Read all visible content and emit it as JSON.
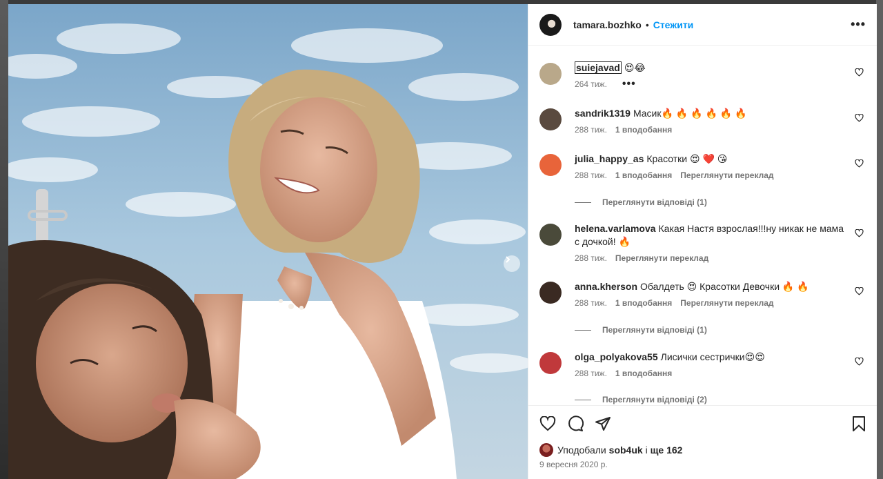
{
  "post": {
    "author": "tamara.bozhko",
    "follow_label": "Стежити",
    "separator": "•",
    "more_label": "•••"
  },
  "comments": [
    {
      "username": "suiejavad",
      "text": "😍😂",
      "time": "264 тиж.",
      "likes": "",
      "translate": "",
      "more": "•••",
      "avatar_color": "#b9a88a"
    },
    {
      "username": "sandrik1319",
      "text": "Масик🔥 🔥 🔥 🔥 🔥 🔥",
      "time": "288 тиж.",
      "likes": "1 вподобання",
      "translate": "",
      "avatar_color": "#5a4a3f"
    },
    {
      "username": "julia_happy_as",
      "text": "Красотки 😍 ❤️ 😘",
      "time": "288 тиж.",
      "likes": "1 вподобання",
      "translate": "Переглянути переклад",
      "avatar_color": "#e8643a"
    },
    {
      "username": "helena.varlamova",
      "text": "Какая Настя взрослая!!!ну никак не мама с дочкой! 🔥",
      "time": "288 тиж.",
      "likes": "",
      "translate": "Переглянути переклад",
      "avatar_color": "#4a4a3a"
    },
    {
      "username": "anna.kherson",
      "text": "Обалдеть 😍 Красотки Девочки 🔥 🔥",
      "time": "288 тиж.",
      "likes": "1 вподобання",
      "translate": "Переглянути переклад",
      "avatar_color": "#3a2a22"
    },
    {
      "username": "olga_polyakova55",
      "text": "Лисички сестрички😍😍",
      "time": "288 тиж.",
      "likes": "1 вподобання",
      "translate": "",
      "avatar_color": "#c0393b"
    }
  ],
  "replies": [
    {
      "label": "Переглянути відповіді (1)"
    },
    {
      "label": "Переглянути відповіді (1)"
    },
    {
      "label": "Переглянути відповіді (2)"
    }
  ],
  "likes": {
    "prefix": "Уподобали",
    "user": "sob4uk",
    "middle": "і",
    "count_text": "ще 162"
  },
  "date": "9 вересня 2020 р."
}
